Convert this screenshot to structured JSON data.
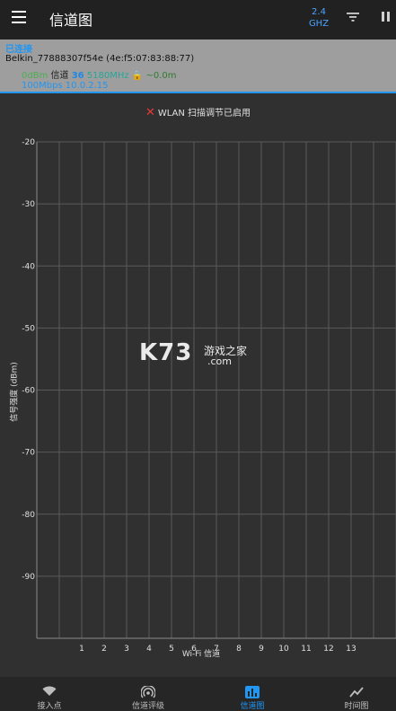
{
  "app": {
    "title": "信道图",
    "band_top": "2.4",
    "band_bottom": "GHZ"
  },
  "icons": {
    "menu": "hamburger-icon",
    "filter": "filter-icon",
    "pause": "pause-icon",
    "warning": "close-x-icon"
  },
  "connection": {
    "status": "已连接",
    "ssid": "Belkin_77888307f54e (4e:f5:07:83:88:77)",
    "dbm": "0dBm",
    "channel_label": "信道",
    "channel": "36",
    "frequency": "5180MHz",
    "lock": "🔒",
    "distance": "~0.0m",
    "link": "100Mbps 10.0.2.15"
  },
  "notice": "WLAN 扫描调节已启用",
  "chart_data": {
    "type": "line",
    "ylabel": "信号强度 (dBm)",
    "xlabel": "Wi-Fi 信道",
    "yticks": [
      -20,
      -30,
      -40,
      -50,
      -60,
      -70,
      -80,
      -90
    ],
    "ylim": [
      -100,
      -20
    ],
    "xticks": [
      1,
      2,
      3,
      4,
      5,
      6,
      7,
      8,
      9,
      10,
      11,
      12,
      13
    ],
    "xlim": [
      -1,
      15
    ],
    "grid": true,
    "series": []
  },
  "watermark": {
    "big": "K73",
    "small": "游戏之家",
    "domain": ".com"
  },
  "nav": [
    {
      "label": "接入点",
      "icon": "wifi-icon",
      "active": false
    },
    {
      "label": "信道评级",
      "icon": "signal-rating-icon",
      "active": false
    },
    {
      "label": "信道图",
      "icon": "bar-chart-icon",
      "active": true
    },
    {
      "label": "时间图",
      "icon": "line-graph-icon",
      "active": false
    }
  ]
}
